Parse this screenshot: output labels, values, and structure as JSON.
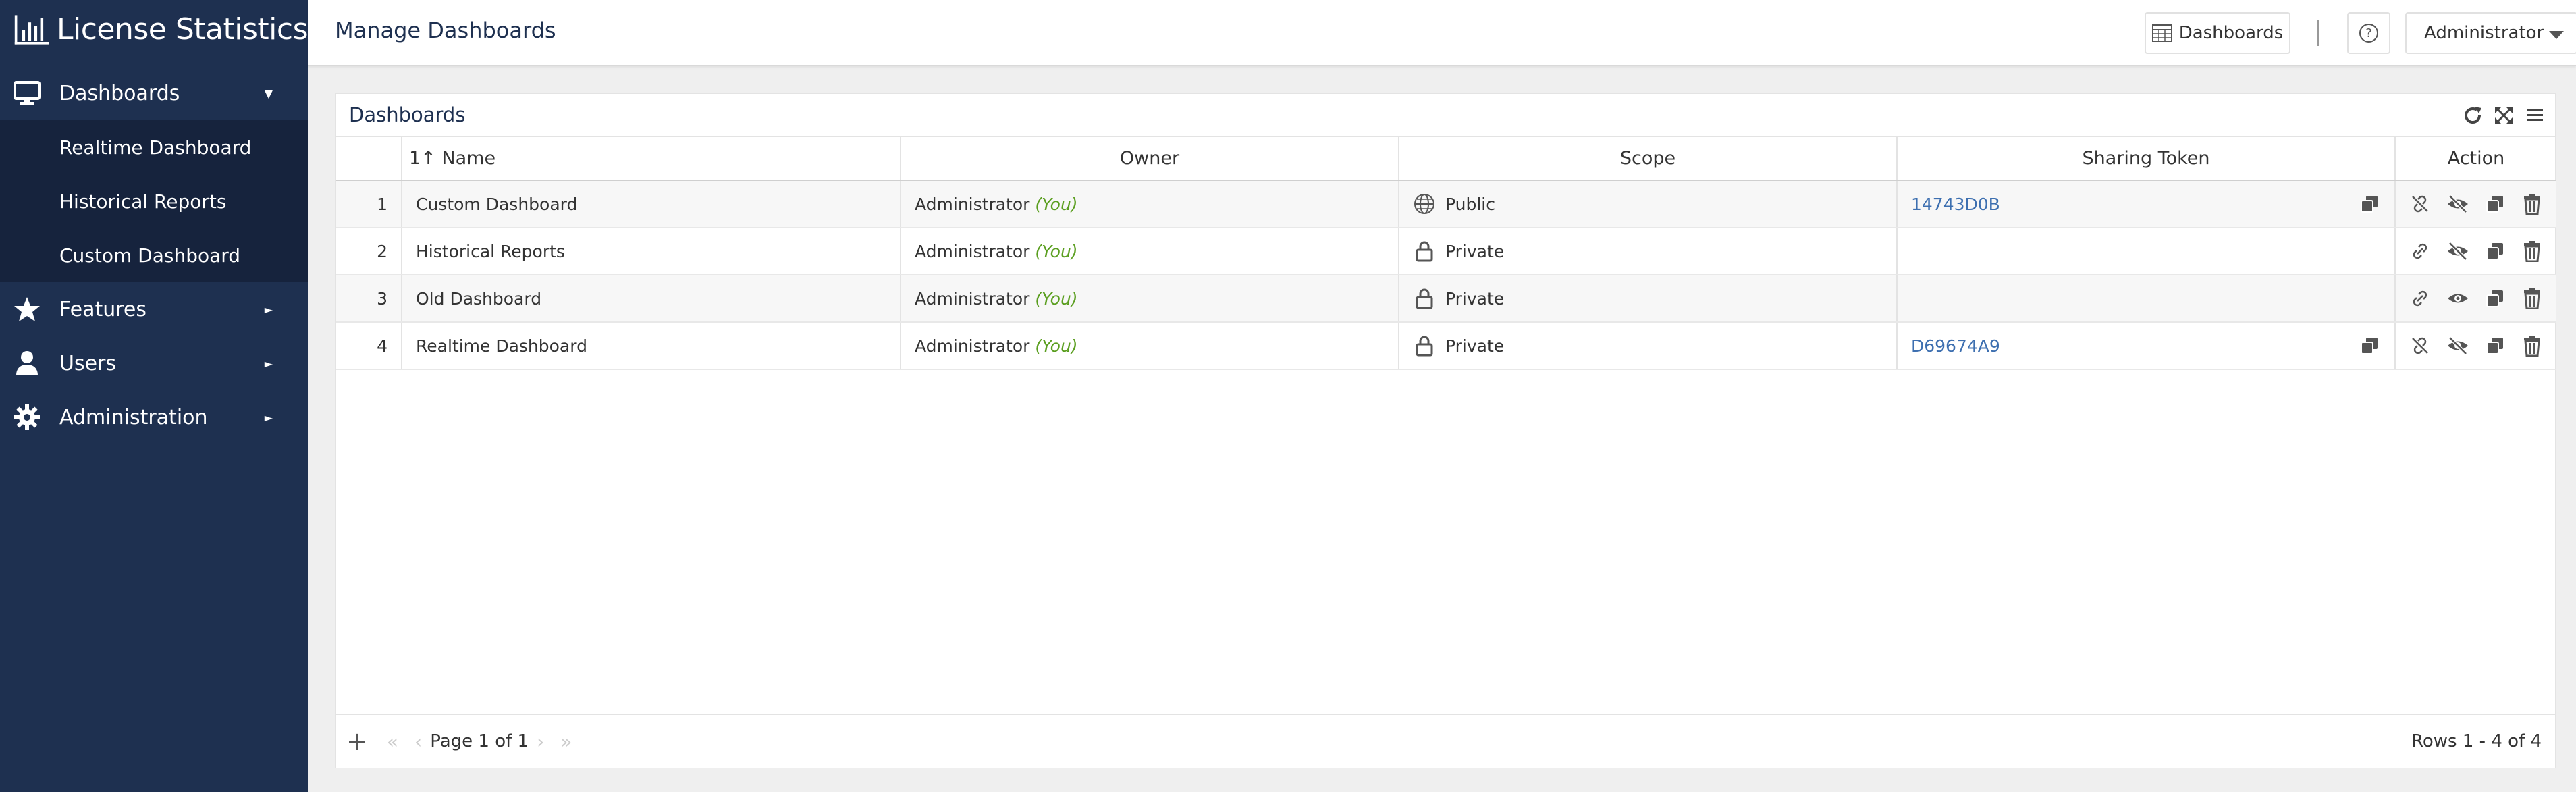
{
  "app": {
    "title": "License Statistics"
  },
  "sidebar": {
    "items": [
      {
        "label": "Dashboards",
        "icon": "monitor-icon",
        "caret": "▼"
      },
      {
        "label": "Features",
        "icon": "star-icon",
        "caret": "►"
      },
      {
        "label": "Users",
        "icon": "user-icon",
        "caret": "►"
      },
      {
        "label": "Administration",
        "icon": "gear-icon",
        "caret": "►"
      }
    ],
    "submenu": [
      {
        "label": "Realtime Dashboard"
      },
      {
        "label": "Historical Reports"
      },
      {
        "label": "Custom Dashboard"
      }
    ]
  },
  "header": {
    "title": "Manage Dashboards",
    "dashboards_button": "Dashboards",
    "user_menu": "Administrator"
  },
  "panel": {
    "title": "Dashboards",
    "columns": [
      "Name",
      "Owner",
      "Scope",
      "Sharing Token",
      "Action"
    ],
    "sort_indicator": "1↑",
    "rows": [
      {
        "num": "1",
        "name": "Custom Dashboard",
        "owner": "Administrator",
        "you": "(You)",
        "scope": "Public",
        "scope_icon": "globe-icon",
        "token": "14743D0B",
        "shared": true,
        "visible": false
      },
      {
        "num": "2",
        "name": "Historical Reports",
        "owner": "Administrator",
        "you": "(You)",
        "scope": "Private",
        "scope_icon": "lock-icon",
        "token": "",
        "shared": false,
        "visible": false
      },
      {
        "num": "3",
        "name": "Old Dashboard",
        "owner": "Administrator",
        "you": "(You)",
        "scope": "Private",
        "scope_icon": "lock-icon",
        "token": "",
        "shared": false,
        "visible": true
      },
      {
        "num": "4",
        "name": "Realtime Dashboard",
        "owner": "Administrator",
        "you": "(You)",
        "scope": "Private",
        "scope_icon": "lock-icon",
        "token": "D69674A9",
        "shared": true,
        "visible": false
      }
    ],
    "footer": {
      "page_label": "Page",
      "page_current": "1",
      "page_of": "of 1",
      "rows_info": "Rows 1 - 4 of 4"
    }
  },
  "colors": {
    "sidebar": "#1e3050",
    "submenu": "#16233d",
    "accent_link": "#3d6fb0",
    "you_text": "#5a9e1f"
  }
}
